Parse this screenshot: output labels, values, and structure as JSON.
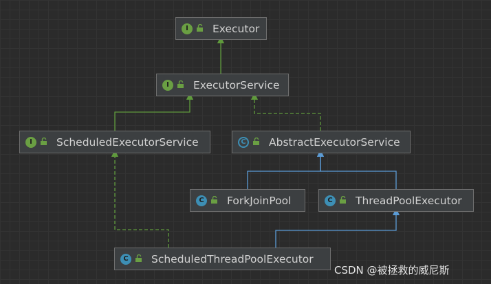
{
  "nodes": [
    {
      "id": "executor",
      "label": "Executor",
      "kind": "interface"
    },
    {
      "id": "executor-service",
      "label": "ExecutorService",
      "kind": "interface"
    },
    {
      "id": "scheduled-executor-service",
      "label": "ScheduledExecutorService",
      "kind": "interface"
    },
    {
      "id": "abstract-executor-service",
      "label": "AbstractExecutorService",
      "kind": "abstract-class"
    },
    {
      "id": "fork-join-pool",
      "label": "ForkJoinPool",
      "kind": "class"
    },
    {
      "id": "thread-pool-executor",
      "label": "ThreadPoolExecutor",
      "kind": "class"
    },
    {
      "id": "scheduled-thread-pool-executor",
      "label": "ScheduledThreadPoolExecutor",
      "kind": "class"
    }
  ],
  "edges": [
    {
      "from": "executor-service",
      "to": "executor",
      "type": "extends"
    },
    {
      "from": "scheduled-executor-service",
      "to": "executor-service",
      "type": "extends"
    },
    {
      "from": "abstract-executor-service",
      "to": "executor-service",
      "type": "implements"
    },
    {
      "from": "fork-join-pool",
      "to": "abstract-executor-service",
      "type": "class-extends"
    },
    {
      "from": "thread-pool-executor",
      "to": "abstract-executor-service",
      "type": "class-extends"
    },
    {
      "from": "scheduled-thread-pool-executor",
      "to": "thread-pool-executor",
      "type": "class-extends"
    },
    {
      "from": "scheduled-thread-pool-executor",
      "to": "scheduled-executor-service",
      "type": "implements"
    }
  ],
  "badges": {
    "interface": "I",
    "class": "C",
    "abstract-class": "C"
  },
  "colors": {
    "interface_edge": "#5f9a3c",
    "class_edge": "#5b9bd5",
    "interface_badge": "#6a9f43",
    "class_badge": "#3d8fb5"
  },
  "watermark": "CSDN @被拯救的威尼斯"
}
